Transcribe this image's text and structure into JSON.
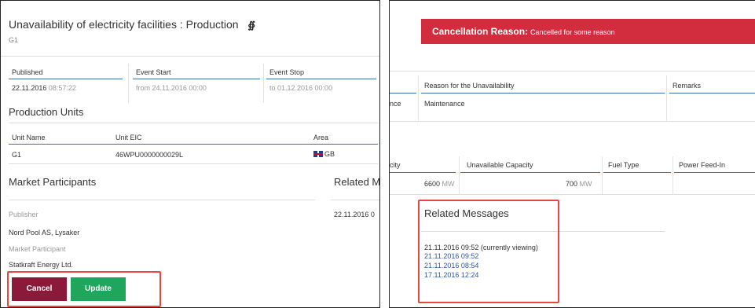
{
  "left": {
    "title": "Unavailability of electricity facilities : Production",
    "rss_icon": "rss-feed-icon",
    "subtitle": "G1",
    "event": {
      "headers": [
        "Published",
        "Event Start",
        "Event Stop"
      ],
      "published_date": "22.11.2016",
      "published_time": "08:57:22",
      "start": "from 24.11.2016 00:00",
      "stop": "to 01.12.2016 00:00"
    },
    "production_units": {
      "heading": "Production Units",
      "headers": [
        "Unit Name",
        "Unit EIC",
        "Area"
      ],
      "row": {
        "name": "G1",
        "eic": "46WPU0000000029L",
        "area": "GB"
      }
    },
    "market_participants": {
      "heading": "Market Participants",
      "publisher_label": "Publisher",
      "publisher": "Nord Pool AS, Lysaker",
      "participant_label": "Market Participant",
      "participant": "Statkraft Energy Ltd."
    },
    "related_heading_cut": "Related M",
    "related_date_cut": "22.11.2016 0",
    "buttons": {
      "cancel": "Cancel",
      "update": "Update"
    }
  },
  "right": {
    "banner": {
      "label": "Cancellation Reason:",
      "reason": "Cancelled for some reason"
    },
    "reason_table": {
      "headers": [
        "Reason for the Unavailability",
        "Remarks"
      ],
      "left_cut": "nce",
      "reason": "Maintenance"
    },
    "capacity_table": {
      "headers": [
        "city",
        "Unavailable Capacity",
        "Fuel Type",
        "Power Feed-In"
      ],
      "installed_value": "6600",
      "installed_unit": "MW",
      "unavailable_value": "700",
      "unavailable_unit": "MW"
    },
    "related_messages": {
      "heading": "Related Messages",
      "current": "21.11.2016 09:52 (currently viewing)",
      "links": [
        "21.11.2016 09:52",
        "21.11.2016 08:54",
        "17.11.2016 12:24"
      ]
    }
  },
  "colors": {
    "banner": "#d12d3e",
    "cancel": "#8b1a3a",
    "update": "#1fa55c",
    "highlight": "#e8473f",
    "rule": "#3b6ea3",
    "link": "#2a57a6"
  }
}
